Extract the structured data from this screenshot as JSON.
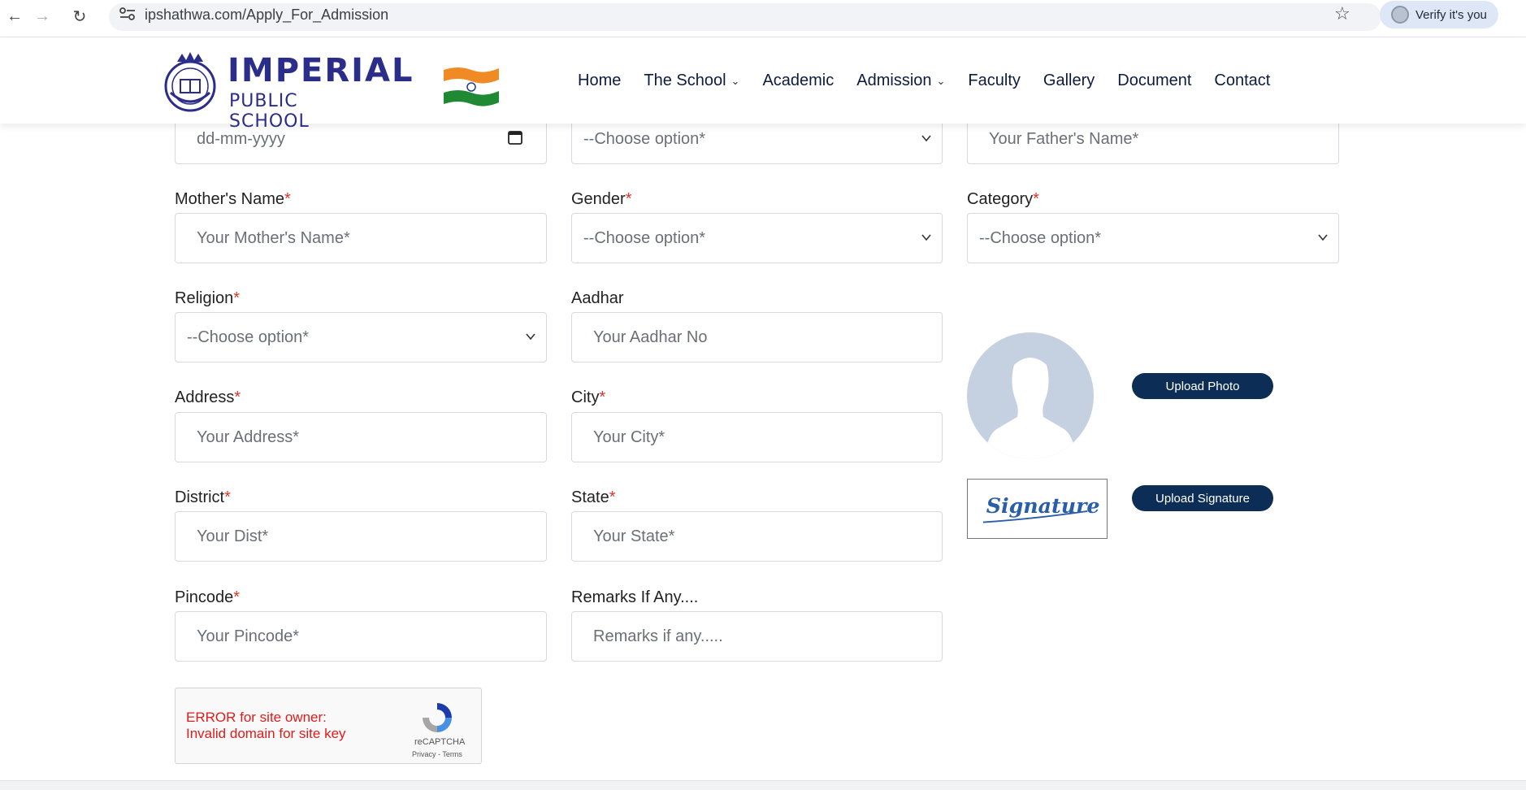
{
  "browser": {
    "url": "ipshathwa.com/Apply_For_Admission",
    "verify_label": "Verify it's you"
  },
  "site": {
    "logo_line1": "IMPERIAL",
    "logo_line2": "PUBLIC SCHOOL",
    "menu": [
      {
        "label": "Home",
        "has_caret": false
      },
      {
        "label": "The School",
        "has_caret": true
      },
      {
        "label": "Academic",
        "has_caret": false
      },
      {
        "label": "Admission",
        "has_caret": true
      },
      {
        "label": "Faculty",
        "has_caret": false
      },
      {
        "label": "Gallery",
        "has_caret": false
      },
      {
        "label": "Document",
        "has_caret": false
      },
      {
        "label": "Contact",
        "has_caret": false
      }
    ]
  },
  "form": {
    "dob_placeholder": "dd-mm-yyyy",
    "top_select_placeholder": "--Choose option*",
    "father_placeholder": "Your Father's Name*",
    "mother_label": "Mother's Name",
    "mother_placeholder": "Your Mother's Name*",
    "gender_label": "Gender",
    "gender_value": "--Choose option*",
    "category_label": "Category",
    "category_value": "--Choose option*",
    "religion_label": "Religion",
    "religion_value": "--Choose option*",
    "aadhar_label": "Aadhar",
    "aadhar_placeholder": "Your Aadhar No",
    "address_label": "Address",
    "address_placeholder": "Your Address*",
    "city_label": "City",
    "city_placeholder": "Your City*",
    "district_label": "District",
    "district_placeholder": "Your Dist*",
    "state_label": "State",
    "state_placeholder": "Your State*",
    "pincode_label": "Pincode",
    "pincode_placeholder": "Your Pincode*",
    "remarks_label": "Remarks If Any....",
    "remarks_placeholder": "Remarks if any.....",
    "required_mark": "*",
    "upload_photo_label": "Upload Photo",
    "upload_signature_label": "Upload Signature",
    "signature_text": "Signature"
  },
  "captcha": {
    "error_line1": "ERROR for site owner:",
    "error_line2": "Invalid domain for site key",
    "name": "reCAPTCHA",
    "links": "Privacy - Terms"
  },
  "colors": {
    "brand_navy": "#0c2d55",
    "logo_blue": "#2b2d8a",
    "required_red": "#d9362b",
    "captcha_error": "#e01b1b"
  }
}
